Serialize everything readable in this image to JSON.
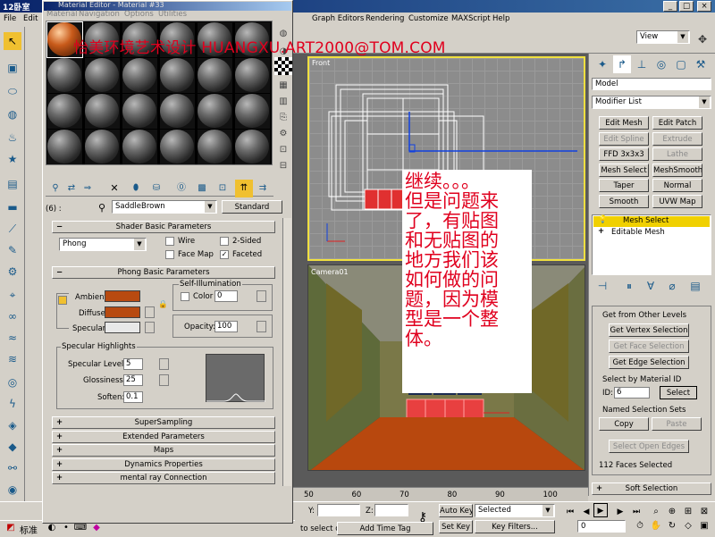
{
  "app": {
    "title_left": "12卧室"
  },
  "menus": {
    "file": "File",
    "edit": "Edit",
    "graph_editors": "Graph Editors",
    "rendering": "Rendering",
    "customize": "Customize",
    "maxscript": "MAXScript",
    "help": "Help",
    "view_dropdown": "View"
  },
  "material_editor": {
    "title": "Material Editor - Material #33",
    "menu": [
      "Material",
      "Navigation",
      "Options",
      "Utilities"
    ],
    "slot_label": "(6) :",
    "material_name": "SaddleBrown",
    "material_type": "Standard",
    "shader_rollout": "Shader Basic Parameters",
    "shader_type": "Phong",
    "wire": "Wire",
    "two_sided": "2-Sided",
    "face_map": "Face Map",
    "faceted": "Faceted",
    "phong_rollout": "Phong Basic Parameters",
    "self_illum_group": "Self-Illumination",
    "color_label": "Color",
    "color_value": "0",
    "ambient": "Ambient:",
    "diffuse": "Diffuse:",
    "specular": "Specular:",
    "opacity_label": "Opacity:",
    "opacity_value": "100",
    "spec_group": "Specular Highlights",
    "spec_level_label": "Specular Level:",
    "spec_level_value": "5",
    "gloss_label": "Glossiness:",
    "gloss_value": "25",
    "soften_label": "Soften:",
    "soften_value": "0.1",
    "rollouts": [
      "SuperSampling",
      "Extended Parameters",
      "Maps",
      "Dynamics Properties",
      "mental ray Connection"
    ],
    "colors": {
      "ambient": "#b84a10",
      "diffuse": "#b84a10",
      "specular": "#e8e8e8"
    }
  },
  "watermark": "怡美环境艺术设计 HUANGXU.ART2000@TOM.COM",
  "viewports": {
    "front": "Front",
    "camera": "Camera01"
  },
  "note_lines": [
    "继续。。。",
    "但是问题来",
    "了，有贴图",
    "和无贴图的",
    "地方我们该",
    "如何做的问",
    "题，因为模",
    "型是一个整",
    "体。"
  ],
  "command_panel": {
    "object_name": "Model",
    "modifier_list": "Modifier List",
    "buttons": [
      {
        "label": "Edit Mesh",
        "enabled": true
      },
      {
        "label": "Edit Patch",
        "enabled": true
      },
      {
        "label": "Edit Spline",
        "enabled": false
      },
      {
        "label": "Extrude",
        "enabled": false
      },
      {
        "label": "FFD 3x3x3",
        "enabled": true
      },
      {
        "label": "Lathe",
        "enabled": false
      },
      {
        "label": "Mesh Select",
        "enabled": true
      },
      {
        "label": "MeshSmooth",
        "enabled": true
      },
      {
        "label": "Taper",
        "enabled": true
      },
      {
        "label": "Normal",
        "enabled": true
      },
      {
        "label": "Smooth",
        "enabled": true
      },
      {
        "label": "UVW Map",
        "enabled": true
      }
    ],
    "stack": [
      "Mesh Select",
      "Editable Mesh"
    ],
    "get_from_other_levels": "Get from Other Levels",
    "get_vertex": "Get Vertex Selection",
    "get_face": "Get Face Selection",
    "get_edge": "Get Edge Selection",
    "select_by_material": "Select by Material ID",
    "id_label": "ID:",
    "id_value": "6",
    "select_btn": "Select",
    "named_sets": "Named Selection Sets",
    "copy": "Copy",
    "paste": "Paste",
    "select_open_edges": "Select Open Edges",
    "faces_selected": "112 Faces Selected",
    "soft_selection": "Soft Selection"
  },
  "timeline": {
    "ticks": [
      "50",
      "60",
      "70",
      "80",
      "90",
      "100"
    ]
  },
  "statusbar": {
    "y_label": "Y:",
    "z_label": "Z:",
    "auto_key": "Auto Key",
    "selected": "Selected",
    "set_key": "Set Key",
    "key_filters": "Key Filters...",
    "frame": "0",
    "add_time_tag": "Add Time Tag",
    "prompt": "to select ob",
    "taskbar_label": "标准"
  }
}
